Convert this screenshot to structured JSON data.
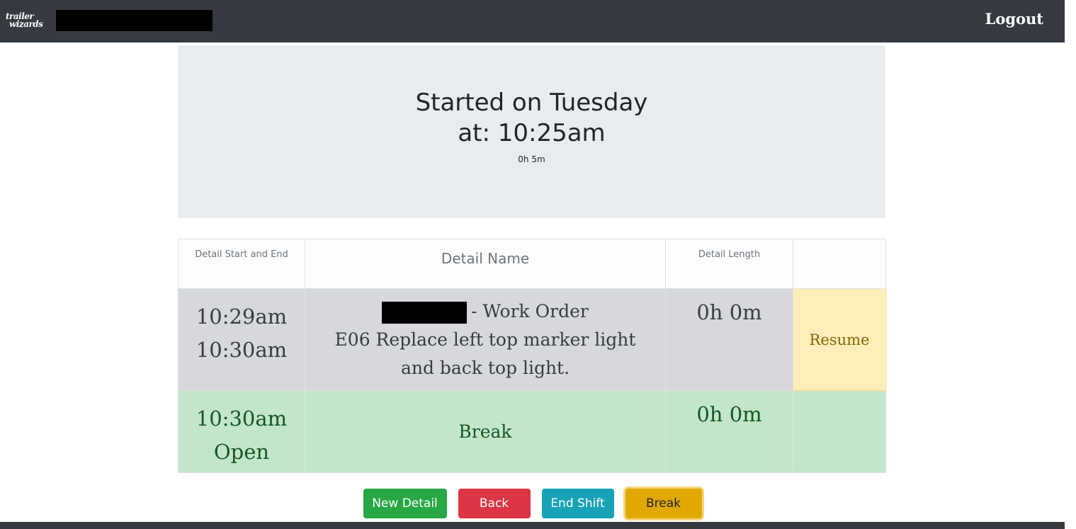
{
  "navbar": {
    "logo_line1": "trailer",
    "logo_line2": "wizards",
    "logout_label": "Logout"
  },
  "shift": {
    "started_line1": "Started on Tuesday",
    "started_line2": "at: 10:25am",
    "elapsed": "0h 5m"
  },
  "table": {
    "headers": {
      "start_end": "Detail Start and End",
      "name": "Detail Name",
      "length": "Detail Length",
      "action": ""
    },
    "rows": [
      {
        "start": "10:29am",
        "end": "10:30am",
        "name_suffix": "- Work Order",
        "description": "E06 Replace left top marker light and back top light.",
        "length": "0h 0m",
        "action": "Resume"
      },
      {
        "start": "10:30am",
        "end": "Open",
        "name": "Break",
        "length": "0h 0m",
        "action": ""
      }
    ]
  },
  "buttons": {
    "new_detail": "New Detail",
    "back": "Back",
    "end_shift": "End Shift",
    "break": "Break"
  }
}
